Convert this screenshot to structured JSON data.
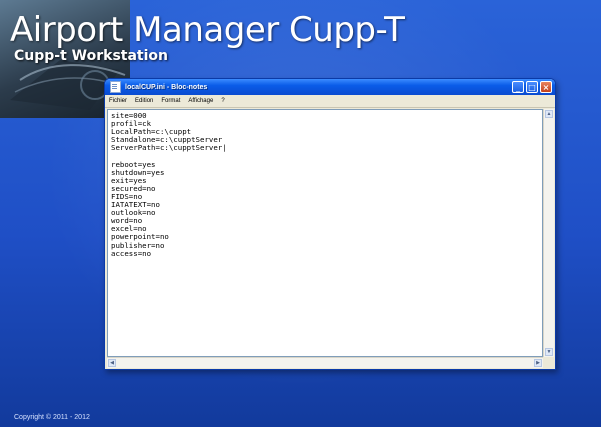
{
  "desktop": {
    "title": "Airport Manager Cupp-T",
    "subtitle": "Cupp-t Workstation",
    "copyright": "Copyright © 2011 - 2012"
  },
  "window": {
    "title": "localCUP.ini - Bloc-notes",
    "buttons": {
      "minimize": "_",
      "maximize": "□",
      "close": "×"
    },
    "menu": [
      "Fichier",
      "Edition",
      "Format",
      "Affichage",
      "?"
    ],
    "content": "site=000\nprofil=ck\nLocalPath=c:\\cuppt\nStandalone=c:\\cupptServer\nServerPath=c:\\cupptServer|\n\nreboot=yes\nshutdown=yes\nexit=yes\nsecured=no\nFIDS=no\nIATATEXT=no\noutlook=no\nword=no\nexcel=no\npowerpoint=no\npublisher=no\naccess=no"
  },
  "colors": {
    "desktop_blue": "#2a63d8",
    "titlebar_blue": "#0a5ce8",
    "close_red": "#c2401c"
  }
}
